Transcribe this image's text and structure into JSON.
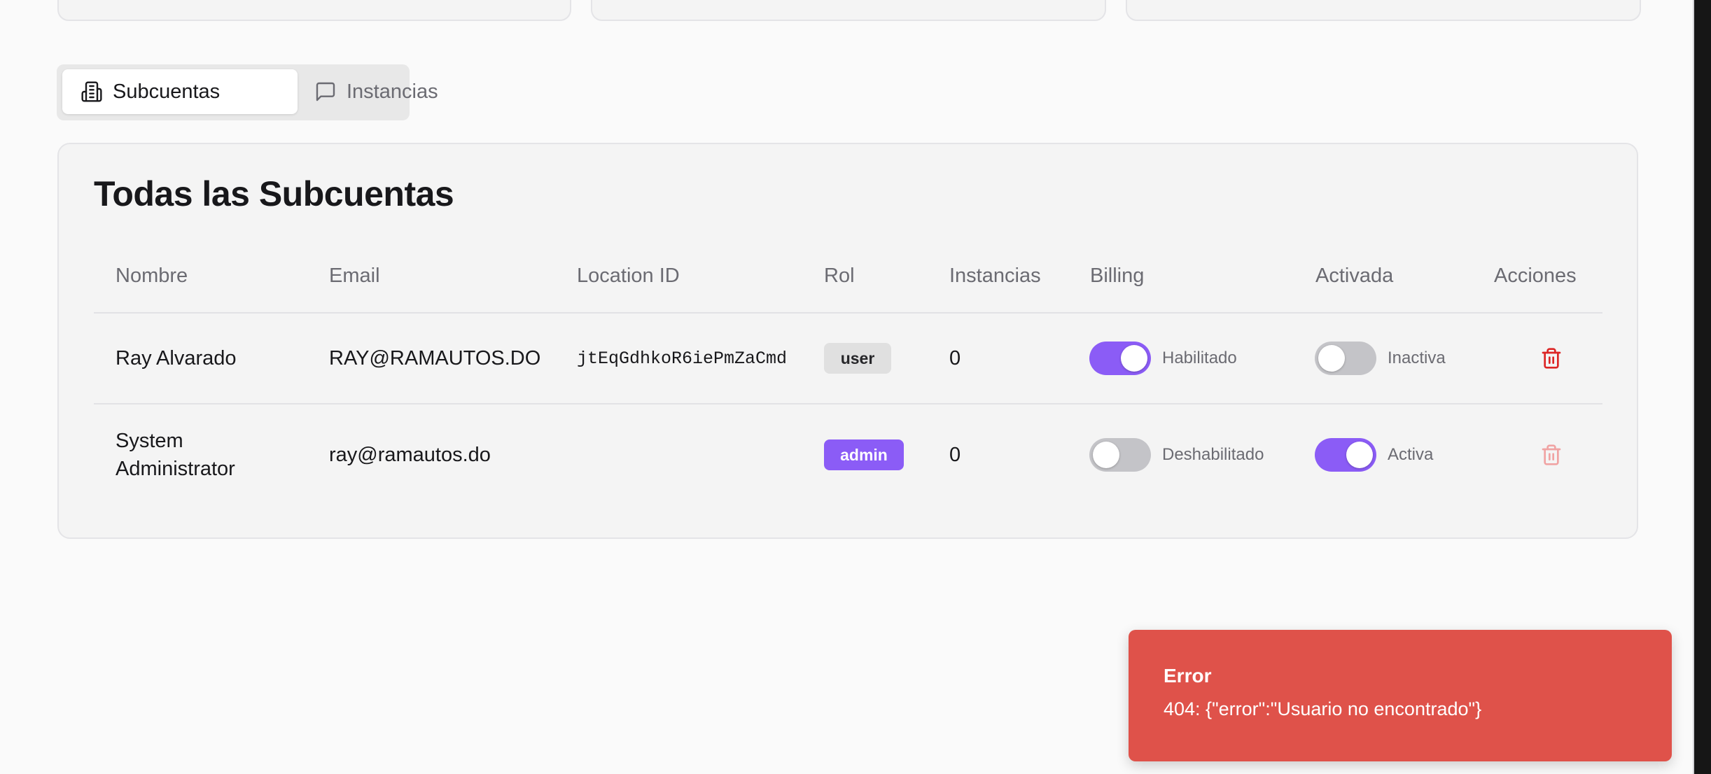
{
  "tabs": [
    {
      "label": "Subcuentas",
      "icon": "building-icon",
      "active": true
    },
    {
      "label": "Instancias",
      "icon": "message-square-icon",
      "active": false
    }
  ],
  "section": {
    "title": "Todas las Subcuentas"
  },
  "table": {
    "columns": [
      "Nombre",
      "Email",
      "Location ID",
      "Rol",
      "Instancias",
      "Billing",
      "Activada",
      "Acciones"
    ],
    "rows": [
      {
        "name": "Ray Alvarado",
        "name_line2": "",
        "email": "RAY@RAMAUTOS.DO",
        "location_id": "jtEqGdhkoR6iePmZaCmd",
        "role": "user",
        "instances": "0",
        "billing_on": true,
        "billing_label": "Habilitado",
        "active_on": false,
        "active_label": "Inactiva",
        "delete_enabled": true
      },
      {
        "name": "System",
        "name_line2": "Administrator",
        "email": "ray@ramautos.do",
        "location_id": "",
        "role": "admin",
        "instances": "0",
        "billing_on": false,
        "billing_label": "Deshabilitado",
        "active_on": true,
        "active_label": "Activa",
        "delete_enabled": false
      }
    ]
  },
  "toast": {
    "title": "Error",
    "message": "404: {\"error\":\"Usuario no encontrado\"}"
  },
  "colors": {
    "accent": "#8b5cf6",
    "danger": "#df524a",
    "trash": "#dc2626"
  }
}
